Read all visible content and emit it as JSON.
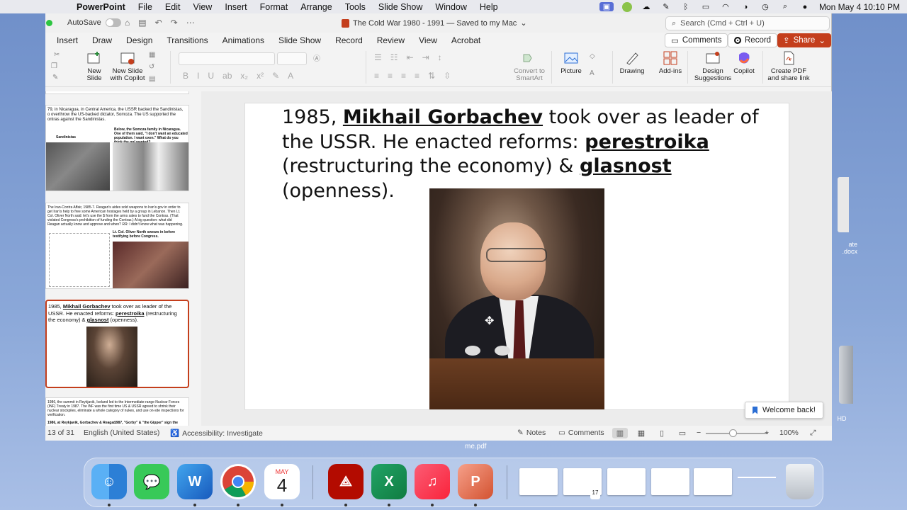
{
  "menubar": {
    "app": "PowerPoint",
    "items": [
      "File",
      "Edit",
      "View",
      "Insert",
      "Format",
      "Arrange",
      "Tools",
      "Slide Show",
      "Window",
      "Help"
    ],
    "clock": "Mon May 4  10:10 PM"
  },
  "titlebar": {
    "autosave_label": "AutoSave",
    "document_title": "The Cold War 1980 - 1991 — Saved to my Mac",
    "search_placeholder": "Search (Cmd + Ctrl + U)"
  },
  "tabs": [
    "Insert",
    "Draw",
    "Design",
    "Transitions",
    "Animations",
    "Slide Show",
    "Record",
    "Review",
    "View",
    "Acrobat"
  ],
  "actions": {
    "comments": "Comments",
    "record": "Record",
    "share": "Share"
  },
  "ribbon": {
    "new_slide": "New Slide",
    "new_slide_copilot": "New Slide with Copilot",
    "convert_smartart": "Convert to SmartArt",
    "picture": "Picture",
    "drawing": "Drawing",
    "addins": "Add-ins",
    "design_suggestions": "Design Suggestions",
    "copilot": "Copilot",
    "create_pdf": "Create PDF and share link"
  },
  "thumbnails": [
    {
      "text": "79, in Nicaragua, in Central America, the USSR backed the Sandinistas, o overthrow the US-backed dictator, Somoza. The US supported the ontras against the Sandinistas.",
      "caption": "Below, the Somoza family in Nicaragua. One of them said, \"I don't want an educated population. I want oxen.\" What do you think the ppl wanted?",
      "label": "Sandinistas"
    },
    {
      "text": "The Iran-Contra Affair, 1985-7. Reagan's aides sold weapons to Iran's gov in order to get Iran's help to free some American hostages held by a group in Lebanon. Then Lt. Col. Oliver North said: let's use the $ from the arms sales to fund the Contras. (That violated Congress's prohibition of funding the Contras.) A big question: what did Reagan actually know and approve and when? RR: I didn't know what was happening.",
      "caption": "Lt. Col. Oliver North swears in before testifying before Congress."
    },
    {
      "text_1": "1985, ",
      "name": "Mikhail Gorbachev",
      "text_2": " took over as leader of the USSR. He enacted reforms: ",
      "term_1": "perestroika",
      "text_3": " (restructuring the economy) & ",
      "term_2": "glasnost",
      "text_4": " (openness)."
    },
    {
      "text": "1986, the summit in Reykjavik, Iceland led to the Intermediate-range Nuclear Forces (INF) Treaty in 1987. The INF was the first time US & USSR agreed to shrink their nuclear stockpiles, eliminate a whole category of nukes, and use on-site inspections for verification.",
      "caption_1": "1986, at Reykjavik, Gorbachev & Reagan",
      "caption_2": "1987, \"Gorby\" & \"the Gipper\" sign the"
    }
  ],
  "slide": {
    "line_1a": "1985, ",
    "name": "Mikhail Gorbachev",
    "line_1b": " took over as leader of the USSR. He enacted reforms: ",
    "term_1": "perestroika",
    "line_2": " (restructuring the economy) & ",
    "term_2": "glasnost",
    "line_3": " (openness)."
  },
  "welcome": "Welcome back!",
  "status": {
    "slide_counter": "13 of 31",
    "language": "English (United States)",
    "accessibility": "Accessibility: Investigate",
    "notes": "Notes",
    "comments": "Comments",
    "zoom": "100%"
  },
  "desktop": {
    "file_1": "ate .docx",
    "file_2": "HD",
    "file_3": "me.pdf"
  },
  "dock": {
    "calendar_month": "MAY",
    "calendar_day": "4",
    "mini_calendar_day": "17"
  }
}
